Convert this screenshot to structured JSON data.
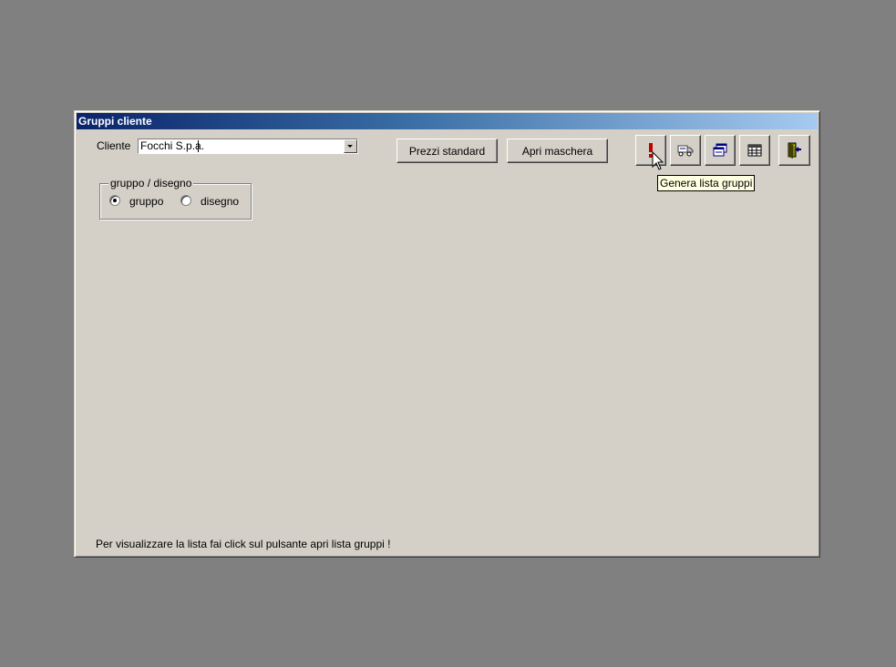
{
  "window": {
    "title": "Gruppi cliente"
  },
  "cliente": {
    "label": "Cliente",
    "value": "Focchi S.p.a."
  },
  "buttons": {
    "prezzi_standard": "Prezzi standard",
    "apri_maschera": "Apri maschera"
  },
  "toolbar": {
    "icons": [
      "exclamation-icon",
      "truck-icon",
      "windows-icon",
      "table-icon",
      "exit-door-icon"
    ],
    "tooltip": "Genera lista gruppi"
  },
  "group": {
    "legend": "gruppo / disegno",
    "options": [
      {
        "label": "gruppo",
        "selected": true
      },
      {
        "label": "disegno",
        "selected": false
      }
    ]
  },
  "status": {
    "message": "Per visualizzare la lista fai click sul pulsante apri lista gruppi !"
  },
  "colors": {
    "face": "#d4d0c8",
    "desktop": "#808080",
    "title_start": "#0a246a",
    "title_end": "#a6caf0",
    "tooltip_bg": "#ffffe1"
  }
}
